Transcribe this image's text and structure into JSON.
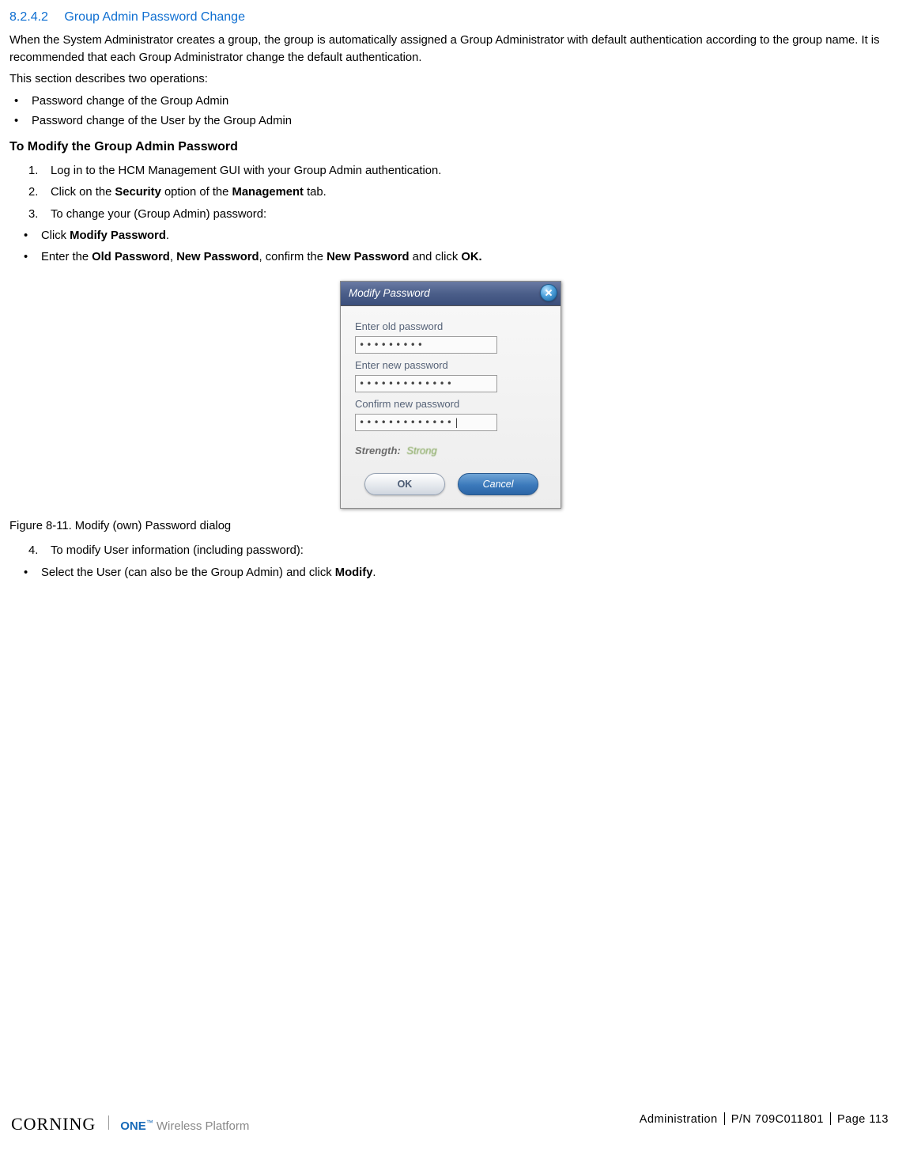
{
  "heading": {
    "number": "8.2.4.2",
    "title": "Group Admin Password Change"
  },
  "intro": "When the System Administrator creates a group, the group is automatically assigned a Group Administrator with default authentication according to the group name. It is recommended that each Group Administrator change the default authentication.",
  "desc": "This section describes two operations:",
  "ops": {
    "a": "Password change of the Group Admin",
    "b": "Password change of the User by the Group Admin"
  },
  "subheading": "To Modify the Group Admin Password",
  "steps": {
    "s1": "Log in to the HCM Management GUI with your Group Admin authentication.",
    "s2_pre": "Click on the ",
    "s2_bold1": "Security",
    "s2_mid": " option of the ",
    "s2_bold2": "Management",
    "s2_post": " tab.",
    "s3": "To change your (Group Admin) password:"
  },
  "sub": {
    "a_pre": "Click ",
    "a_bold": "Modify Password",
    "a_post": ".",
    "b_pre": "Enter the ",
    "b_b1": "Old Password",
    "b_mid1": ", ",
    "b_b2": "New Password",
    "b_mid2": ", confirm the ",
    "b_b3": "New Password",
    "b_mid3": " and click ",
    "b_b4": "OK."
  },
  "dialog": {
    "title": "Modify Password",
    "label_old": "Enter old password",
    "label_new": "Enter new password",
    "label_confirm": "Confirm new password",
    "val_old": "•••••••••",
    "val_new": "•••••••••••••",
    "val_confirm": "•••••••••••••|",
    "strength_label": "Strength:",
    "strength_value": "Strong",
    "ok": "OK",
    "cancel": "Cancel"
  },
  "figure": "Figure 8-11. Modify (own) Password dialog",
  "step4": {
    "num": "4.",
    "text": "To modify User information (including password):"
  },
  "sub4": {
    "pre": "Select the User (can also be the Group Admin) and click ",
    "bold": "Modify",
    "post": "."
  },
  "footer": {
    "section": "Administration",
    "pn": "P/N 709C011801",
    "page": "Page 113",
    "brand1": "CORNING",
    "brand2": "ONE",
    "tm": "™",
    "tag": "Wireless Platform"
  }
}
